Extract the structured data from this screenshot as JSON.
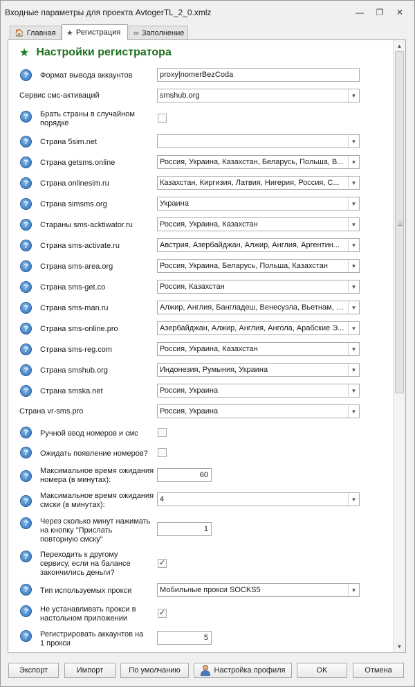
{
  "window": {
    "title": "Входные параметры для проекта AvtogerTL_2_0.xmlz",
    "minimize_glyph": "—",
    "restore_glyph": "❐",
    "close_glyph": "✕"
  },
  "tabs": [
    {
      "label": "Главная",
      "icon": "home-icon",
      "glyph": "🏠"
    },
    {
      "label": "Регистрация",
      "icon": "star-icon",
      "glyph": "★"
    },
    {
      "label": "Заполнение",
      "icon": "infinity-icon",
      "glyph": "∞"
    }
  ],
  "section": {
    "title": "Настройки регистратора",
    "star": "★"
  },
  "help_glyph": "?",
  "check_glyph": "✓",
  "dropdown_glyph": "▼",
  "fields": {
    "output_format": {
      "label": "Формат вывода аккаунтов",
      "value": "proxy|nomerBezCoda"
    },
    "sms_service": {
      "label": "Сервис смс-активаций",
      "value": "smshub.org"
    },
    "random_order": {
      "label": "Брать страны в случайном порядке",
      "checked": false
    },
    "c_5sim": {
      "label": "Страна 5sim.net",
      "value": ""
    },
    "c_getsms": {
      "label": "Страна getsms.online",
      "value": "Россия, Украина, Казахстан, Беларусь, Польша, В..."
    },
    "c_onlinesim": {
      "label": "Страна onlinesim.ru",
      "value": "Казахстан, Киргизия, Латвия, Нигерия, Россия, С..."
    },
    "c_simsms": {
      "label": "Страна simsms.org",
      "value": "Украина"
    },
    "c_actiwator": {
      "label": "Стараны sms-acktiwator.ru",
      "value": "Россия, Украина, Казахстан"
    },
    "c_activate": {
      "label": "Страна sms-activate.ru",
      "value": "Австрия, Азербайджан, Алжир, Англия, Аргентин..."
    },
    "c_area": {
      "label": "Страна sms-area.org",
      "value": "Россия, Украина, Беларусь, Польша, Казахстан"
    },
    "c_get": {
      "label": "Страна sms-get.co",
      "value": "Россия, Казахстан"
    },
    "c_man": {
      "label": "Страна sms-man.ru",
      "value": "Алжир, Англия, Бангладеш, Венесуэла, Вьетнам, Г..."
    },
    "c_online": {
      "label": "Страна sms-online.pro",
      "value": "Азербайджан, Алжир, Англия, Ангола, Арабские Э..."
    },
    "c_reg": {
      "label": "Страна sms-reg.com",
      "value": "Россия, Украина, Казахстан"
    },
    "c_smshub": {
      "label": "Страна smshub.org",
      "value": "Индонезия, Румыния, Украина"
    },
    "c_smska": {
      "label": "Страна smska.net",
      "value": "Россия, Украина"
    },
    "c_vrsms": {
      "label": "Страна vr-sms.pro",
      "value": "Россия, Украина"
    },
    "manual_input": {
      "label": "Ручной ввод номеров и смс",
      "checked": false
    },
    "wait_numbers": {
      "label": "Ожидать появление номеров?",
      "checked": false
    },
    "max_wait_number": {
      "label1": "Максимальное время ожидания",
      "label2": "номера (в минутах):",
      "value": "60"
    },
    "max_wait_sms": {
      "label1": "Максимальное время ожидания",
      "label2": "смски (в минутах):",
      "value": "4"
    },
    "resend_after": {
      "label1": "Через сколько минут нажимать",
      "label2": "на кнопку \"Прислать",
      "label3": "повторную смску\"",
      "value": "1"
    },
    "switch_service": {
      "label1": "Переходить к другому",
      "label2": "сервису, если на балансе",
      "label3": "закончились деньги?",
      "checked": true
    },
    "proxy_type": {
      "label": "Тип используемых прокси",
      "value": "Мобильные прокси SOCKS5"
    },
    "no_desktop_proxy": {
      "label1": "Не устанавливать прокси в",
      "label2": "настольном приложении",
      "checked": true
    },
    "accounts_per_proxy": {
      "label1": "Регистрировать аккаунтов на",
      "label2": "1 прокси",
      "value": "5"
    }
  },
  "buttons": {
    "export": "Экспорт",
    "import": "Импорт",
    "default": "По умолчанию",
    "profile": "Настройка профиля",
    "ok": "OK",
    "cancel": "Отмена"
  }
}
